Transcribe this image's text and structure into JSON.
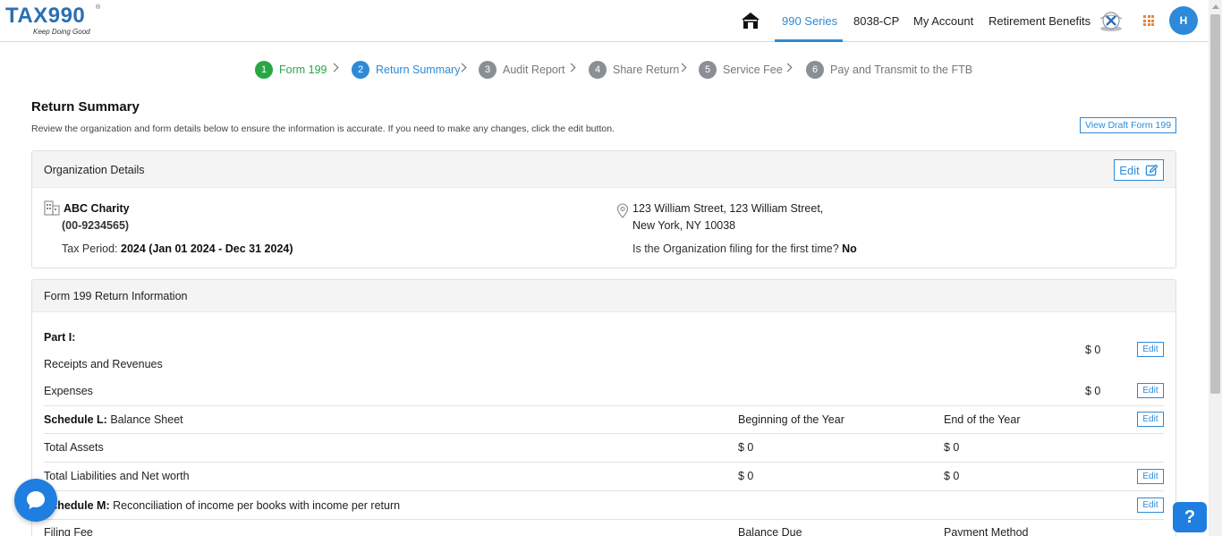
{
  "header": {
    "logo_text_a": "TA",
    "logo_text_x": "X",
    "logo_text_b": "990",
    "logo_reg": "®",
    "logo_tagline": "Keep Doing Good",
    "nav": [
      {
        "label": "990 Series",
        "active": true
      },
      {
        "label": "8038-CP",
        "active": false
      },
      {
        "label": "My Account",
        "active": false
      },
      {
        "label": "Retirement Benefits",
        "active": false
      }
    ],
    "avatar_initial": "H",
    "accent_color": "#2d8ad8"
  },
  "stepper": [
    {
      "num": "1",
      "label": "Form 199",
      "state": "done"
    },
    {
      "num": "2",
      "label": "Return Summary",
      "state": "current"
    },
    {
      "num": "3",
      "label": "Audit Report",
      "state": "pending"
    },
    {
      "num": "4",
      "label": "Share Return",
      "state": "pending"
    },
    {
      "num": "5",
      "label": "Service Fee",
      "state": "pending"
    },
    {
      "num": "6",
      "label": "Pay and Transmit to the FTB",
      "state": "pending"
    }
  ],
  "page": {
    "title": "Return Summary",
    "description": "Review the organization and form details below to ensure the information is accurate. If you need to make any changes, click the edit button.",
    "draft_button": "View Draft Form 199"
  },
  "org": {
    "card_title": "Organization Details",
    "edit_label": "Edit",
    "name": "ABC Charity",
    "ein": "(00-9234565)",
    "tax_period_label": "Tax Period: ",
    "tax_period_value": "2024 (Jan 01 2024 - Dec 31 2024)",
    "address_line1": "123 William Street, 123 William Street,",
    "address_line2": "New York, NY 10038",
    "first_time_label": "Is the Organization filing for the first time? ",
    "first_time_value": "No"
  },
  "return_info": {
    "card_title": "Form 199 Return Information",
    "edit_label": "Edit",
    "part1_label": "Part I:",
    "receipts_label": "Receipts and Revenues",
    "receipts_amount": "$ 0",
    "expenses_label": "Expenses",
    "expenses_amount": "$ 0",
    "schedule_l_bold": "Schedule L:",
    "schedule_l_label": " Balance Sheet",
    "col_begin": "Beginning of the Year",
    "col_end": "End of the Year",
    "total_assets_label": "Total Assets",
    "total_assets_begin": "$ 0",
    "total_assets_end": "$ 0",
    "total_liab_label": "Total Liabilities and Net worth",
    "total_liab_begin": "$ 0",
    "total_liab_end": "$ 0",
    "schedule_m_bold": "Schedule M:",
    "schedule_m_label": " Reconciliation of income per books with income per return",
    "filing_fee_label": "Filing Fee",
    "balance_due_label": "Balance Due",
    "payment_method_label": "Payment Method"
  },
  "help_label": "?"
}
